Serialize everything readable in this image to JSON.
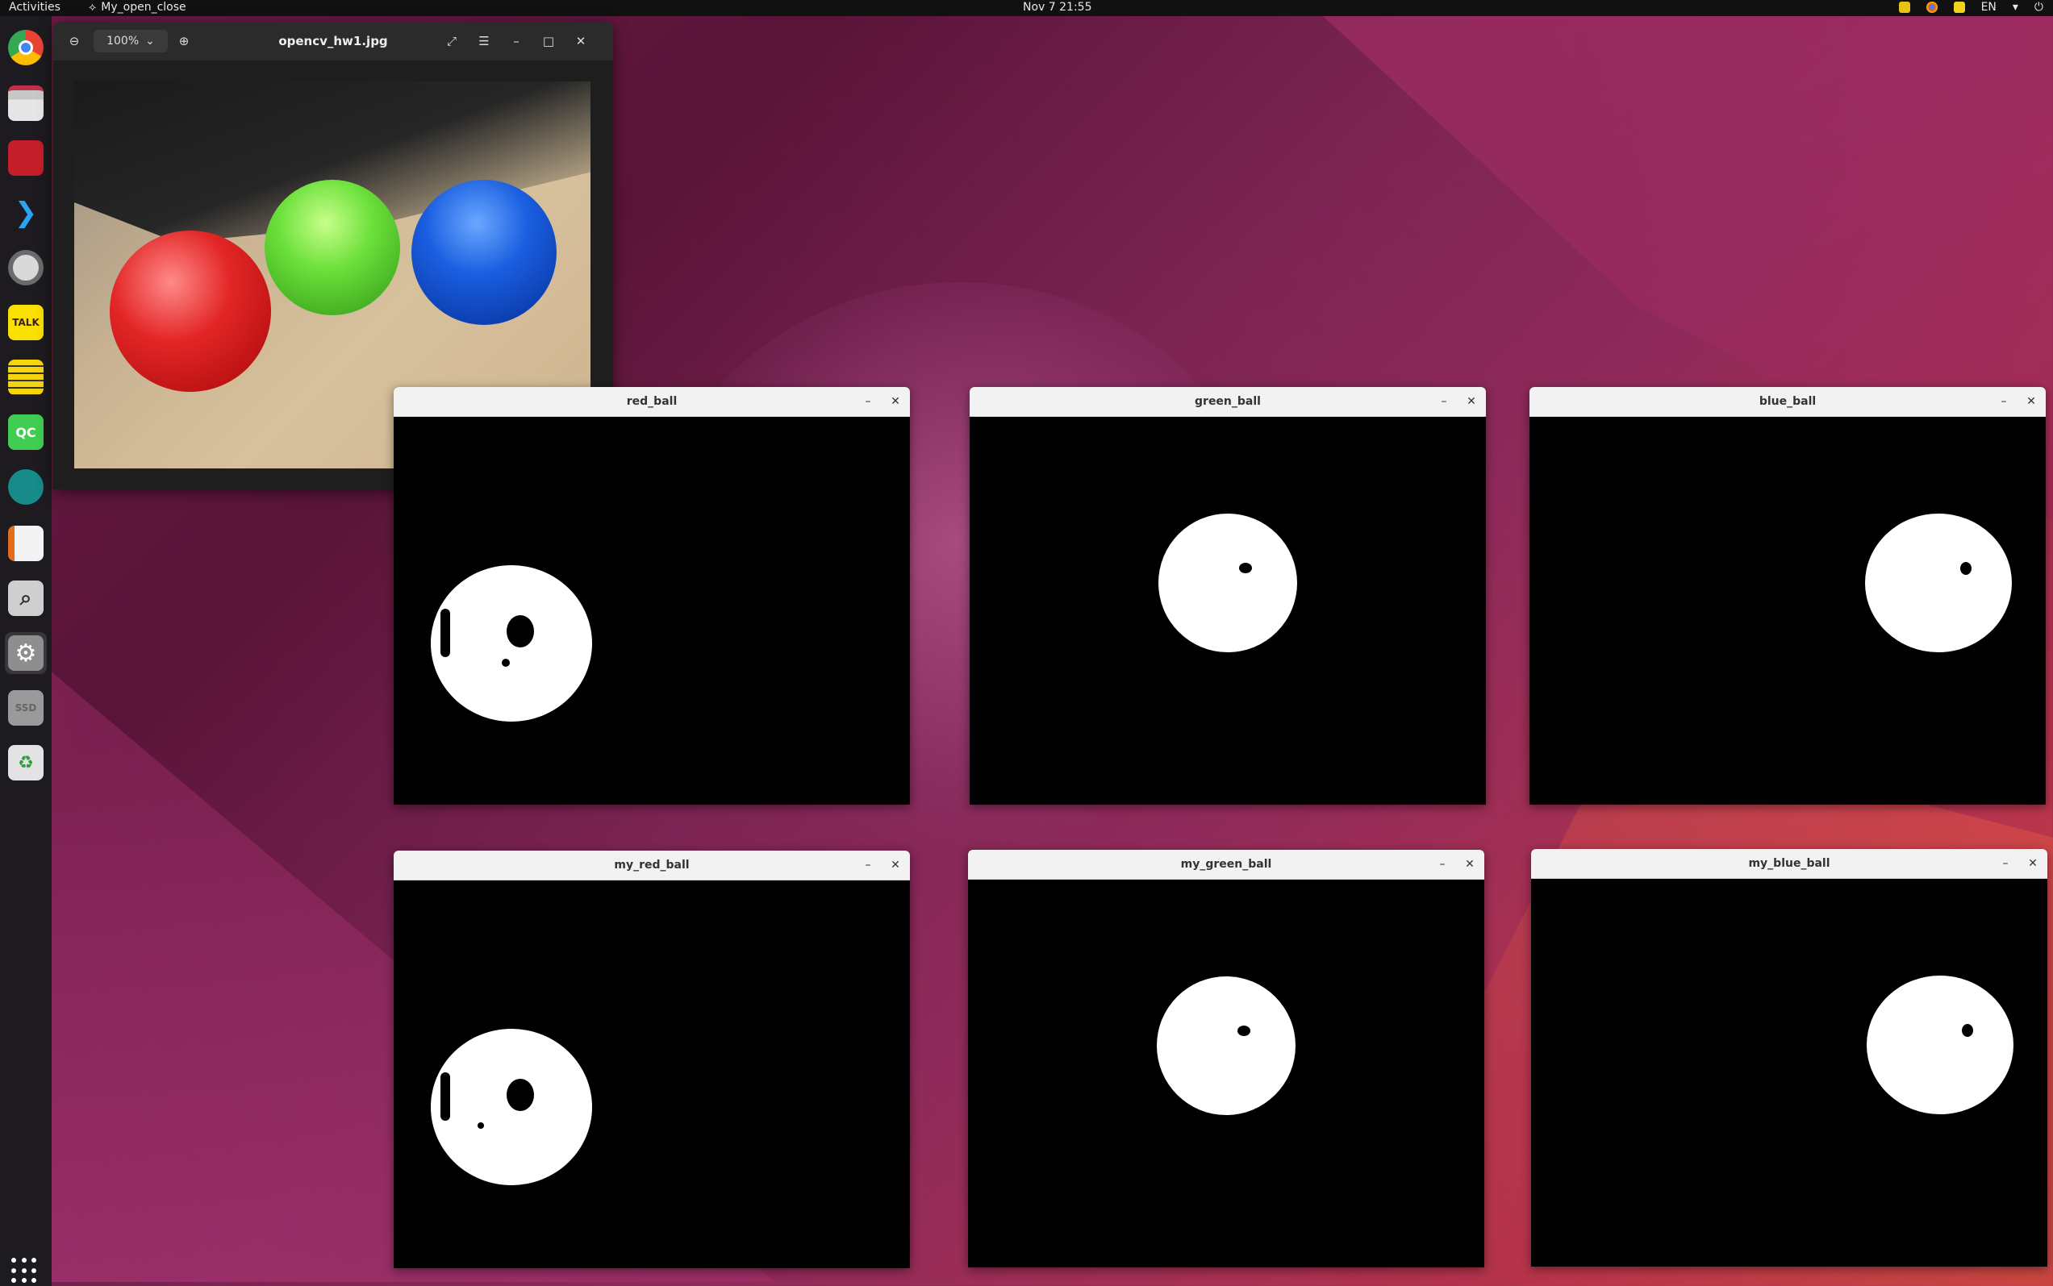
{
  "topbar": {
    "activities": "Activities",
    "app_name": "My_open_close",
    "clock": "Nov 7  21:55",
    "lang": "EN"
  },
  "dock": {
    "items": [
      "chrome-icon",
      "files-icon",
      "presentation-icon",
      "vscode-icon",
      "settings-disc-icon",
      "kakaotalk-icon",
      "notes-icon",
      "qtcreator-icon",
      "gitkraken-icon",
      "impress-icon",
      "search-icon",
      "gear-icon",
      "ssd-icon",
      "trash-icon"
    ],
    "qt_label": "QC",
    "talk_label": "TALK",
    "ssd_label": "SSD"
  },
  "viewer": {
    "zoom": "100%",
    "title": "opencv_hw1.jpg"
  },
  "windows": {
    "red_ball": "red_ball",
    "green_ball": "green_ball",
    "blue_ball": "blue_ball",
    "my_red_ball": "my_red_ball",
    "my_green_ball": "my_green_ball",
    "my_blue_ball": "my_blue_ball"
  },
  "colors": {
    "topbar": "#111111",
    "dock": "#1d1b1f",
    "mask_background": "#000000",
    "mask_foreground": "#ffffff"
  }
}
